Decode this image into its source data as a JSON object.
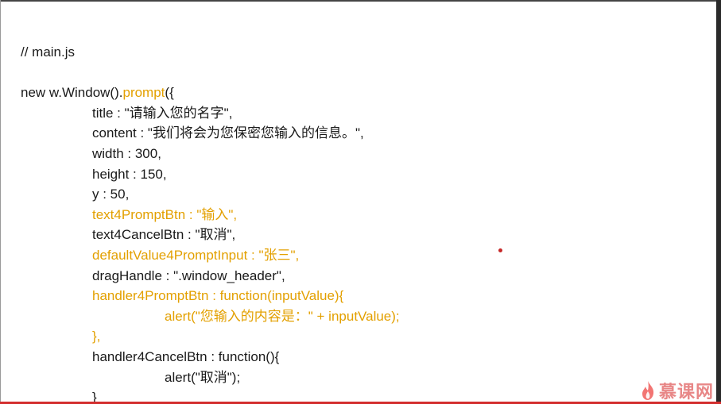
{
  "code": {
    "comment": "// main.js",
    "line_blank": "",
    "line_call_a": "new w.Window().",
    "line_call_b": "prompt",
    "line_call_c": "({",
    "title": "title : \"请输入您的名字\",",
    "content": "content : \"我们将会为您保密您输入的信息。\",",
    "width": "width : 300,",
    "height": "height : 150,",
    "y": "y : 50,",
    "text4PromptBtn": "text4PromptBtn : \"输入\",",
    "text4CancelBtn": "text4CancelBtn : \"取消\",",
    "defaultValue": "defaultValue4PromptInput : \"张三\",",
    "dragHandle": "dragHandle : \".window_header\",",
    "handlerPrompt": "handler4PromptBtn : function(inputValue){",
    "alertPrompt": "alert(\"您输入的内容是：\" + inputValue);",
    "closePrompt": "},",
    "handlerCancel": "handler4CancelBtn : function(){",
    "alertCancel": "alert(\"取消\");",
    "closeCancel": "}"
  },
  "logo": {
    "text": "慕课网",
    "icon": "flame-icon"
  },
  "colors": {
    "highlight": "#e3a000",
    "text": "#1a1a1a",
    "accent": "#d32e2e"
  }
}
